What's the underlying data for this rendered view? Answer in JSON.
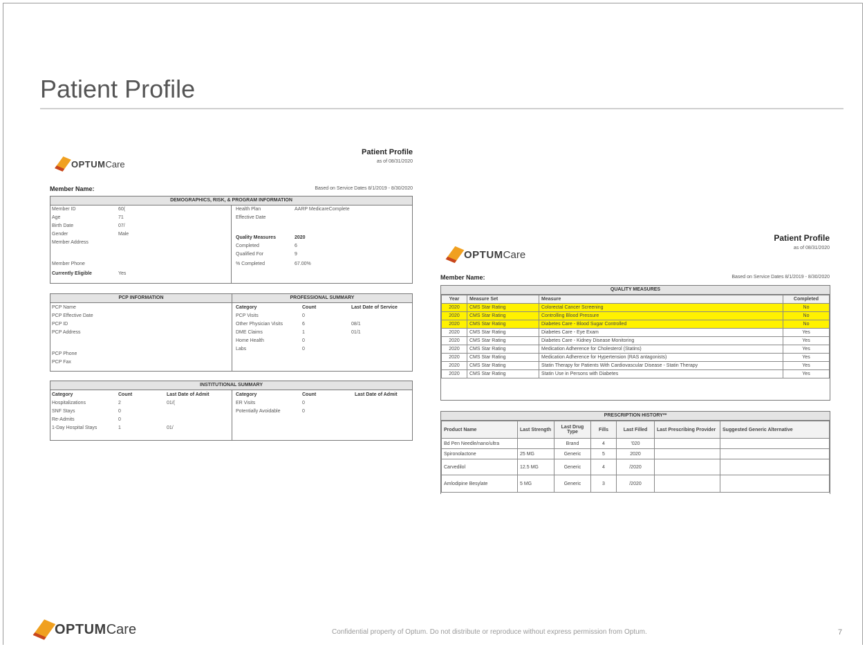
{
  "slide": {
    "title": "Patient Profile",
    "footer": "Confidential  property of Optum.  Do not distribute or reproduce  without  express permission from Optum.",
    "page_number": "7",
    "logo_brand": "OPTUM",
    "logo_care": "Care",
    "colors": {
      "highlight": "#fff200",
      "logo_orange": "#f0a020",
      "logo_red": "#c8461e"
    }
  },
  "doc1": {
    "title": "Patient Profile",
    "as_of": "as of 08/31/2020",
    "member_label": "Member Name:",
    "based_on": "Based on Service Dates 8/1/2019 - 8/30/2020",
    "demographics": {
      "header": "DEMOGRAPHICS, RISK, & PROGRAM INFORMATION",
      "rows": [
        {
          "label": "Member ID",
          "value": "60("
        },
        {
          "label": "Age",
          "value": "71"
        },
        {
          "label": "Birth Date",
          "value": "07/"
        },
        {
          "label": "Gender",
          "value": "Male"
        },
        {
          "label": "Member Address",
          "value": ""
        },
        {
          "label": "Member Phone",
          "value": ""
        },
        {
          "label": "Currently Eligible",
          "value": "Yes"
        }
      ],
      "right_rows": [
        {
          "label": "Health Plan",
          "value": "AARP MedicareComplete"
        },
        {
          "label": "Effective Date",
          "value": ""
        },
        {
          "label": "Quality Measures",
          "value": "2020"
        },
        {
          "label": "Completed",
          "value": "6"
        },
        {
          "label": "Qualified For",
          "value": "9"
        },
        {
          "label": "% Completed",
          "value": "67.00%"
        }
      ]
    },
    "pcp": {
      "header": "PCP INFORMATION",
      "rows": [
        "PCP Name",
        "PCP Effective Date",
        "PCP ID",
        "PCP Address",
        "PCP Phone",
        "PCP Fax"
      ]
    },
    "professional": {
      "header": "PROFESSIONAL SUMMARY",
      "columns": [
        "Category",
        "Count",
        "Last Date of Service"
      ],
      "rows": [
        {
          "category": "PCP Visits",
          "count": "0",
          "date": ""
        },
        {
          "category": "Other Physician Visits",
          "count": "6",
          "date": "08/1"
        },
        {
          "category": "DME Claims",
          "count": "1",
          "date": "01/1"
        },
        {
          "category": "Home Health",
          "count": "0",
          "date": ""
        },
        {
          "category": "Labs",
          "count": "0",
          "date": ""
        }
      ]
    },
    "institutional": {
      "header": "INSTITUTIONAL SUMMARY",
      "columns": [
        "Category",
        "Count",
        "Last Date of Admit"
      ],
      "left_rows": [
        {
          "category": "Hospitalizations",
          "count": "2",
          "date": "01/("
        },
        {
          "category": "SNF Stays",
          "count": "0",
          "date": ""
        },
        {
          "category": "Re-Admits",
          "count": "0",
          "date": ""
        },
        {
          "category": "1-Day Hospital Stays",
          "count": "1",
          "date": "01/"
        }
      ],
      "right_rows": [
        {
          "category": "ER Visits",
          "count": "0",
          "date": ""
        },
        {
          "category": "Potentially Avoidable",
          "count": "0",
          "date": ""
        }
      ]
    }
  },
  "doc2": {
    "title": "Patient Profile",
    "as_of": "as of 08/31/2020",
    "member_label": "Member Name:",
    "based_on": "Based on Service Dates 8/1/2019 - 8/30/2020",
    "quality": {
      "header": "QUALITY MEASURES",
      "columns": [
        "Year",
        "Measure Set",
        "Measure",
        "Completed"
      ],
      "rows": [
        {
          "year": "2020",
          "set": "CMS Star Rating",
          "measure": "Colorectal Cancer Screening",
          "completed": "No",
          "highlight": true
        },
        {
          "year": "2020",
          "set": "CMS Star Rating",
          "measure": "Controlling Blood Pressure",
          "completed": "No",
          "highlight": true
        },
        {
          "year": "2020",
          "set": "CMS Star Rating",
          "measure": "Diabetes Care - Blood Sugar Controlled",
          "completed": "No",
          "highlight": true
        },
        {
          "year": "2020",
          "set": "CMS Star Rating",
          "measure": "Diabetes Care - Eye Exam",
          "completed": "Yes",
          "highlight": false
        },
        {
          "year": "2020",
          "set": "CMS Star Rating",
          "measure": "Diabetes Care - Kidney Disease Monitoring",
          "completed": "Yes",
          "highlight": false
        },
        {
          "year": "2020",
          "set": "CMS Star Rating",
          "measure": "Medication Adherence for Cholesterol (Statins)",
          "completed": "Yes",
          "highlight": false
        },
        {
          "year": "2020",
          "set": "CMS Star Rating",
          "measure": "Medication Adherence for Hypertension (RAS antagonists)",
          "completed": "Yes",
          "highlight": false
        },
        {
          "year": "2020",
          "set": "CMS Star Rating",
          "measure": "Statin Therapy for Patients With Cardiovascular Disease - Statin Therapy",
          "completed": "Yes",
          "highlight": false
        },
        {
          "year": "2020",
          "set": "CMS Star Rating",
          "measure": "Statin Use in Persons with Diabetes",
          "completed": "Yes",
          "highlight": false
        }
      ]
    },
    "prescriptions": {
      "header": "PRESCRIPTION HISTORY**",
      "columns": [
        "Product Name",
        "Last Strength",
        "Last Drug Type",
        "Fills",
        "Last Filled",
        "Last Prescribing Provider",
        "Suggested Generic Alternative"
      ],
      "rows": [
        {
          "product": "Bd Pen Needle/nano/ultra",
          "strength": "",
          "type": "Brand",
          "fills": "4",
          "filled": "'020",
          "provider": "",
          "generic": ""
        },
        {
          "product": "Spironolactone",
          "strength": "25 MG",
          "type": "Generic",
          "fills": "5",
          "filled": "2020",
          "provider": "",
          "generic": ""
        },
        {
          "product": "Carvedilol",
          "strength": "12.5 MG",
          "type": "Generic",
          "fills": "4",
          "filled": "/2020",
          "provider": "",
          "generic": ""
        },
        {
          "product": "Amlodipine Besylate",
          "strength": "5 MG",
          "type": "Generic",
          "fills": "3",
          "filled": "/2020",
          "provider": "",
          "generic": ""
        }
      ]
    }
  }
}
